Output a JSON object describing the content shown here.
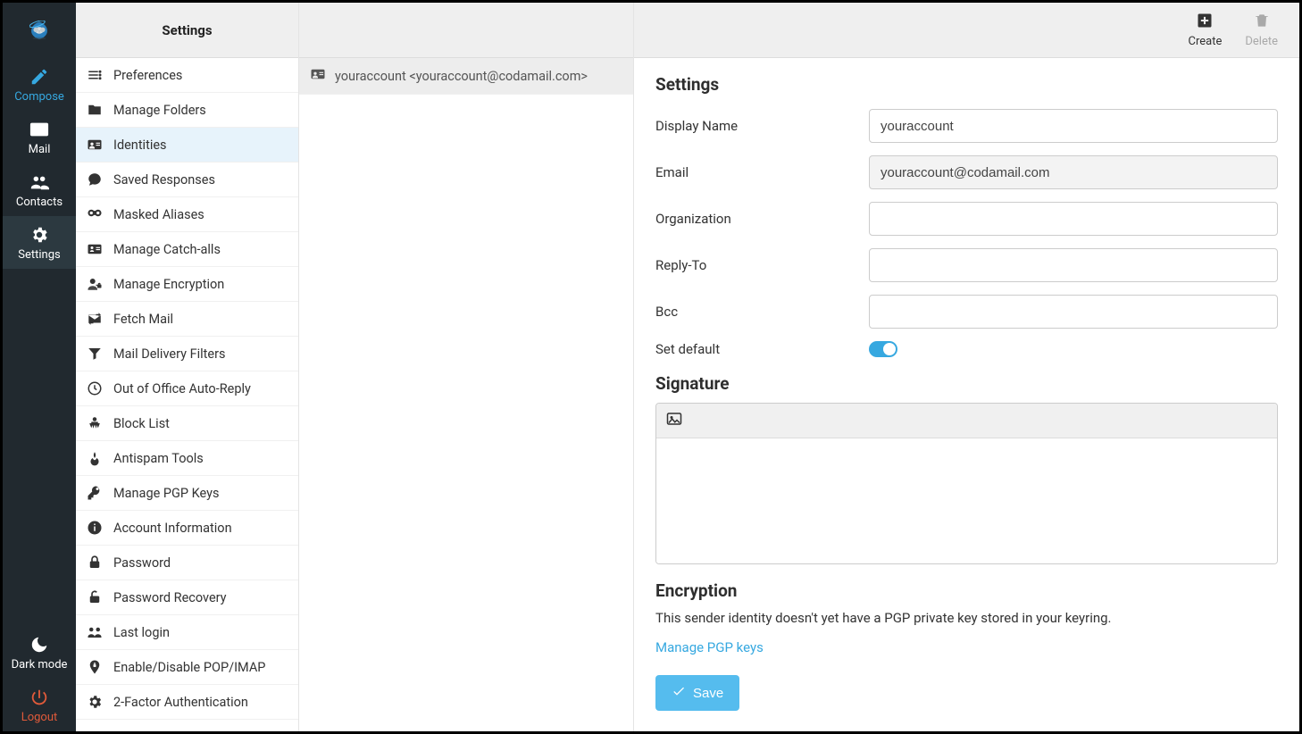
{
  "nav": {
    "compose": "Compose",
    "mail": "Mail",
    "contacts": "Contacts",
    "settings": "Settings",
    "darkmode": "Dark mode",
    "logout": "Logout"
  },
  "settings_panel": {
    "title": "Settings",
    "items": [
      "Preferences",
      "Manage Folders",
      "Identities",
      "Saved Responses",
      "Masked Aliases",
      "Manage Catch-alls",
      "Manage Encryption",
      "Fetch Mail",
      "Mail Delivery Filters",
      "Out of Office Auto-Reply",
      "Block List",
      "Antispam Tools",
      "Manage PGP Keys",
      "Account Information",
      "Password",
      "Password Recovery",
      "Last login",
      "Enable/Disable POP/IMAP",
      "2-Factor Authentication"
    ],
    "active_index": 2
  },
  "identities": {
    "items": [
      "youraccount <youraccount@codamail.com>"
    ]
  },
  "toolbar": {
    "create": "Create",
    "delete": "Delete"
  },
  "form": {
    "heading": "Settings",
    "labels": {
      "display_name": "Display Name",
      "email": "Email",
      "organization": "Organization",
      "reply_to": "Reply-To",
      "bcc": "Bcc",
      "set_default": "Set default"
    },
    "values": {
      "display_name": "youraccount",
      "email": "youraccount@codamail.com",
      "organization": "",
      "reply_to": "",
      "bcc": ""
    },
    "set_default_on": true,
    "signature_heading": "Signature",
    "encryption_heading": "Encryption",
    "encryption_text": "This sender identity doesn't yet have a PGP private key stored in your keyring.",
    "manage_pgp_link": "Manage PGP keys",
    "save": "Save"
  }
}
